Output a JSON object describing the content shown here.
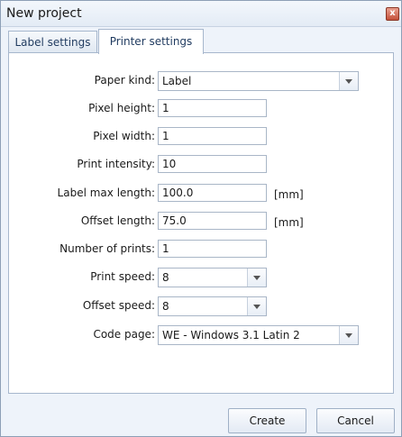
{
  "window": {
    "title": "New project",
    "close_glyph": "x"
  },
  "tabs": [
    {
      "label": "Label settings",
      "active": false
    },
    {
      "label": "Printer settings",
      "active": true
    }
  ],
  "form": {
    "paper_kind": {
      "label": "Paper kind:",
      "value": "Label"
    },
    "pixel_height": {
      "label": "Pixel height:",
      "value": "1"
    },
    "pixel_width": {
      "label": "Pixel width:",
      "value": "1"
    },
    "print_intensity": {
      "label": "Print intensity:",
      "value": "10"
    },
    "label_max_length": {
      "label": "Label max length:",
      "value": "100.0",
      "unit": "[mm]"
    },
    "offset_length": {
      "label": "Offset length:",
      "value": "75.0",
      "unit": "[mm]"
    },
    "number_of_prints": {
      "label": "Number of prints:",
      "value": "1"
    },
    "print_speed": {
      "label": "Print speed:",
      "value": "8"
    },
    "offset_speed": {
      "label": "Offset speed:",
      "value": "8"
    },
    "code_page": {
      "label": "Code page:",
      "value": "WE - Windows 3.1 Latin 2"
    }
  },
  "buttons": {
    "create": "Create",
    "cancel": "Cancel"
  },
  "colors": {
    "window_bg": "#eef3fa",
    "border": "#8d9fb6",
    "close_red": "#c4513a"
  }
}
